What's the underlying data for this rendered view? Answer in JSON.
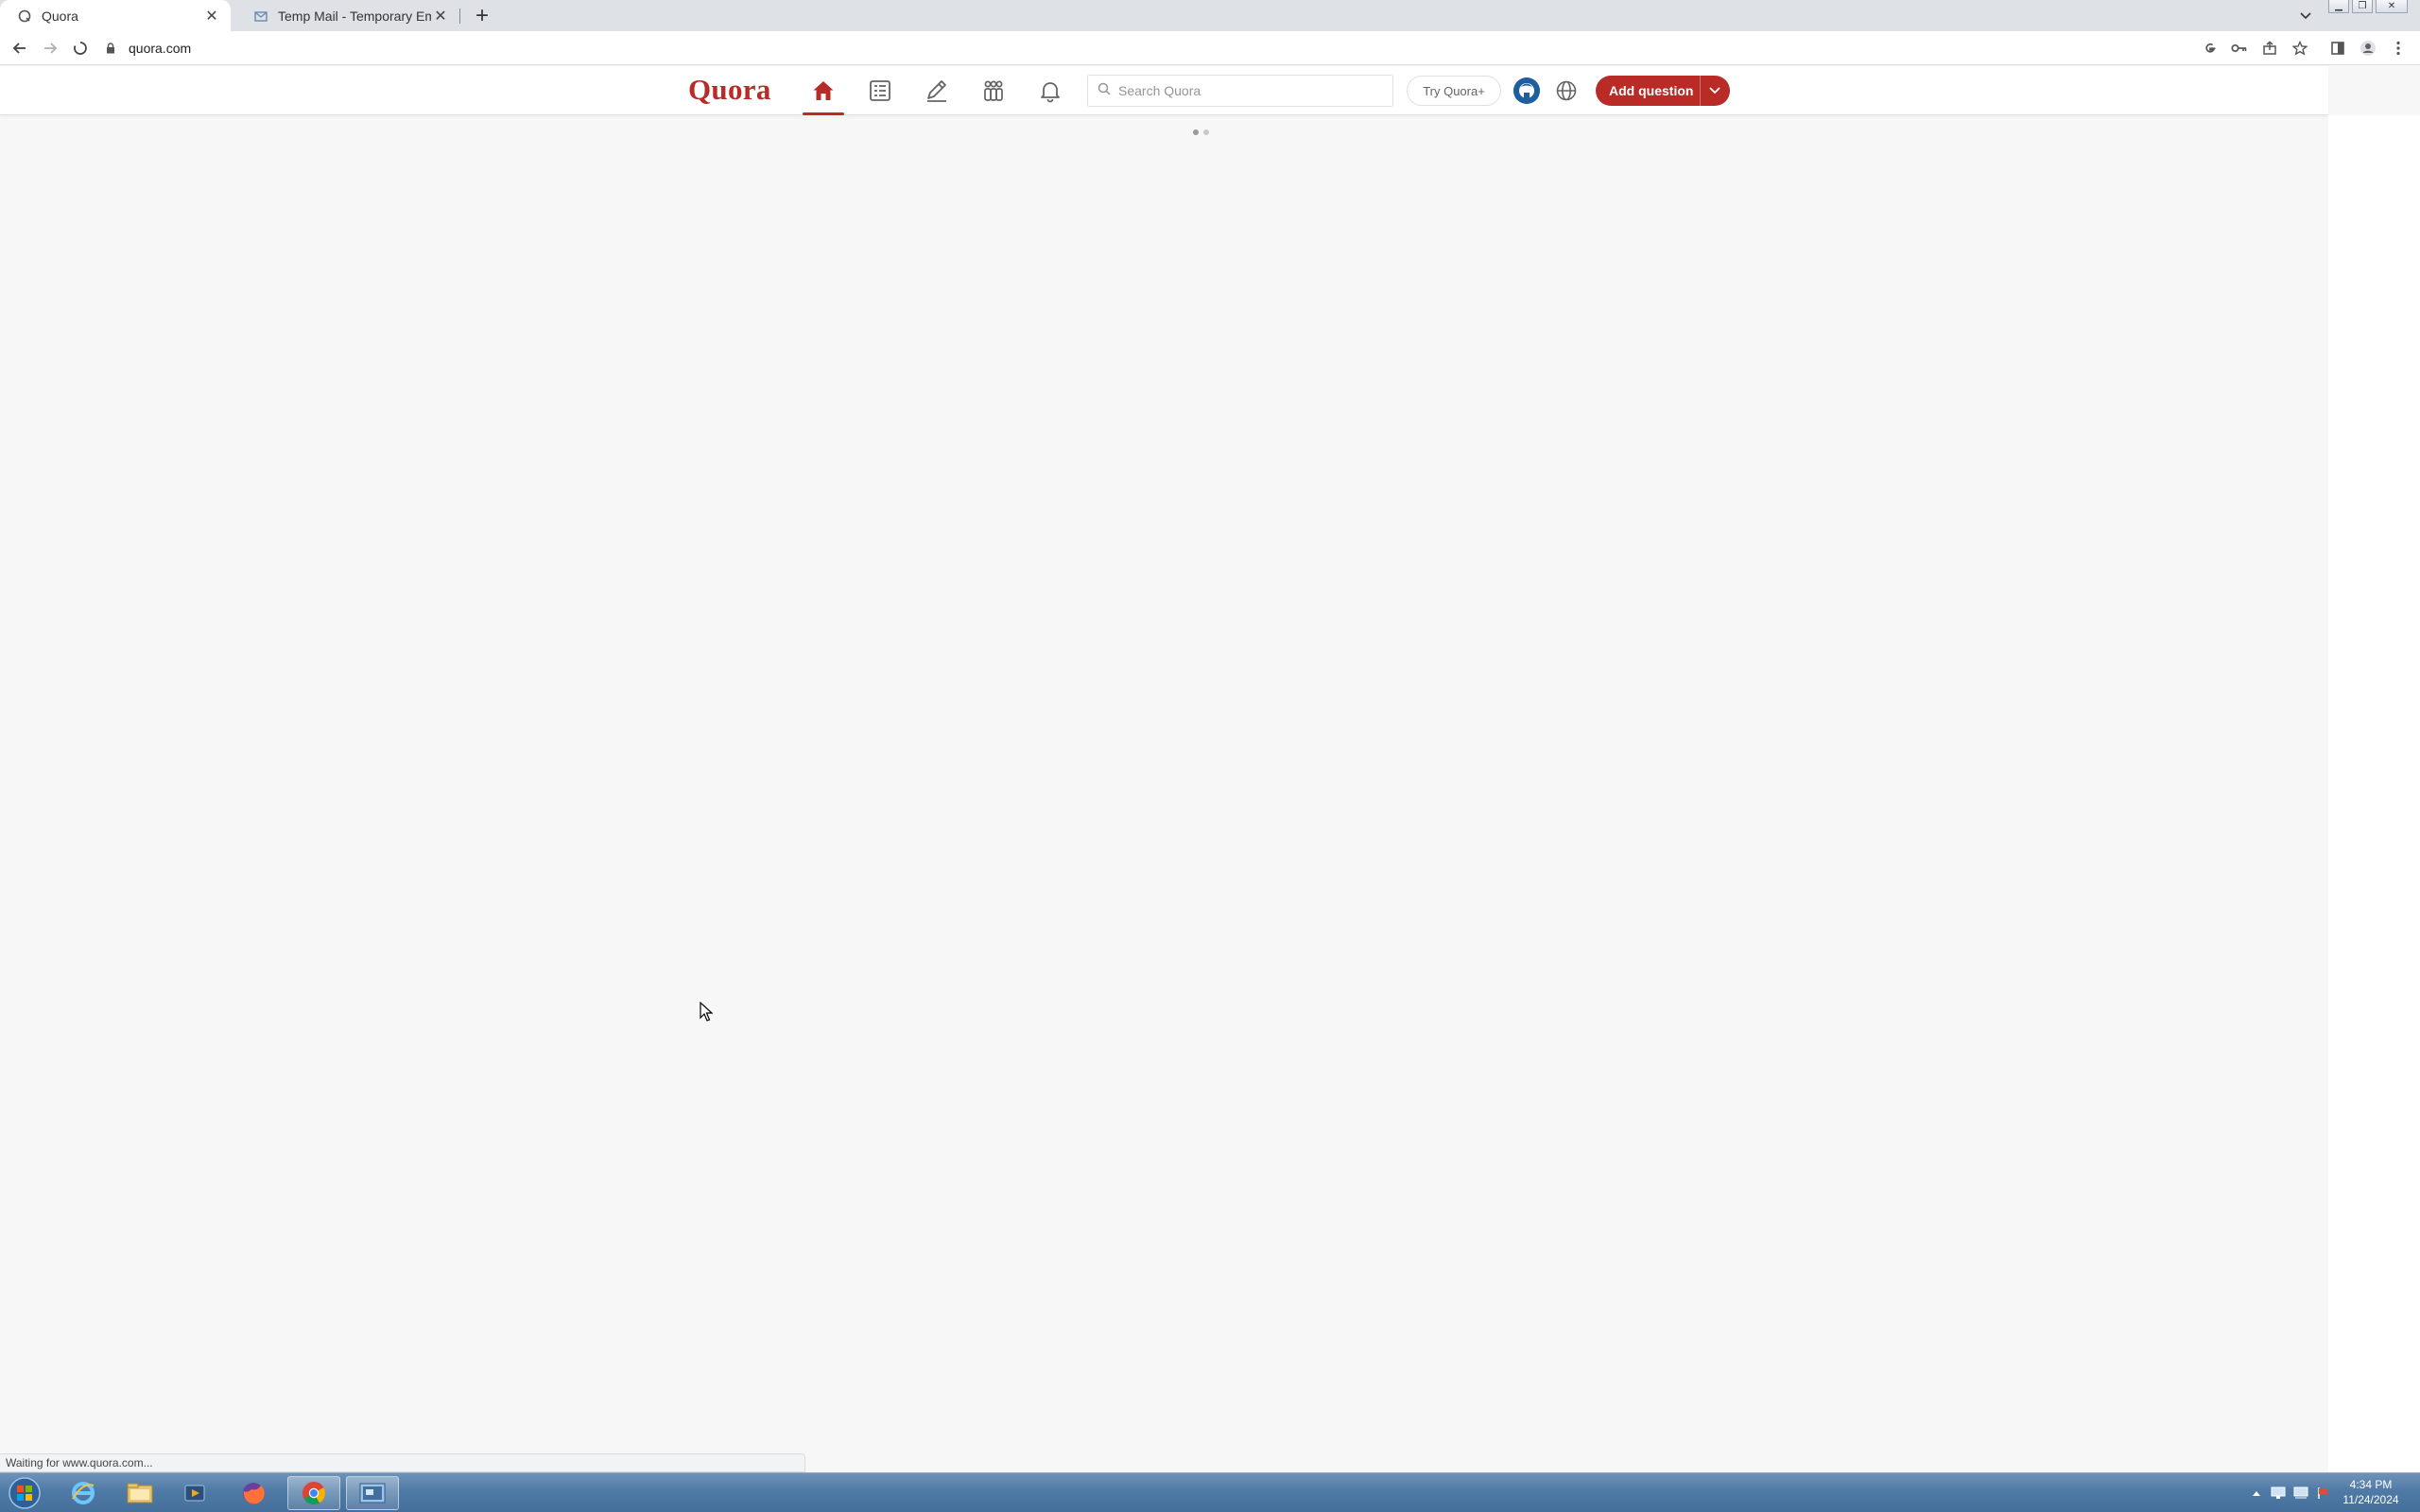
{
  "browser": {
    "tabs": [
      {
        "title": "Quora",
        "active": true
      },
      {
        "title": "Temp Mail - Temporary Email",
        "active": false
      }
    ],
    "url": "quora.com",
    "status_text": "Waiting for www.quora.com..."
  },
  "quora": {
    "logo": "Quora",
    "nav": [
      "home-icon",
      "following-icon",
      "answer-icon",
      "spaces-icon",
      "notifications-icon"
    ],
    "search_placeholder": "Search Quora",
    "try_plus": "Try Quora+",
    "add_question": "Add question"
  },
  "taskbar": {
    "apps": [
      "internet-explorer-icon",
      "file-explorer-icon",
      "media-player-icon",
      "firefox-icon",
      "chrome-icon",
      "screenshot-tool-icon"
    ],
    "time": "4:34 PM",
    "date": "11/24/2024"
  },
  "colors": {
    "brand": "#b92b27",
    "page_bg": "#f7f7f7",
    "taskbar": "#4f7aa6"
  }
}
